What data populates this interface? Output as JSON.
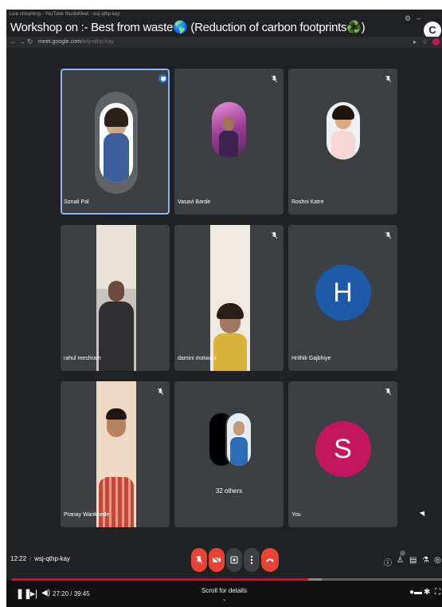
{
  "browser": {
    "tabs": [
      "Live streaming - YouTube Studio",
      "Meet - wsj-qthp-kay"
    ],
    "url_host": "meet.google.com",
    "url_path": "/wsj-qthp-kay",
    "profile_initial": "C"
  },
  "video_title": "Workshop on :- Best from waste🌎 (Reduction of carbon footprints♻️)",
  "participants": [
    {
      "name": "Sonali Pal",
      "type": "photo",
      "speaking": true
    },
    {
      "name": "Vasavi Barde",
      "type": "photo",
      "muted": true
    },
    {
      "name": "Roshni Katre",
      "type": "photo",
      "muted": true
    },
    {
      "name": "rahul meshram",
      "type": "video"
    },
    {
      "name": "damini motwani",
      "type": "video",
      "muted": true
    },
    {
      "name": "Hrithik Gajbhiye",
      "type": "letter",
      "letter": "H",
      "color": "#1e5aa8",
      "muted": true
    },
    {
      "name": "Pranay Wankhede",
      "type": "video",
      "muted": true
    },
    {
      "name": "",
      "type": "others",
      "others_label": "32 others"
    },
    {
      "name": "You",
      "type": "letter",
      "letter": "S",
      "color": "#c2185b",
      "muted": true
    }
  ],
  "callbar": {
    "time": "12:22",
    "meeting_code": "wsj-qthp-kay"
  },
  "player": {
    "current_time": "27:20",
    "duration": "39:45",
    "time_display": "27:20 / 39:45",
    "scroll_hint": "Scroll for details",
    "progress": 0.688,
    "loaded": 0.72
  },
  "colors": {
    "accent": "#8ab4f8",
    "end_call": "#ea4335",
    "progress": "#ff0000"
  }
}
